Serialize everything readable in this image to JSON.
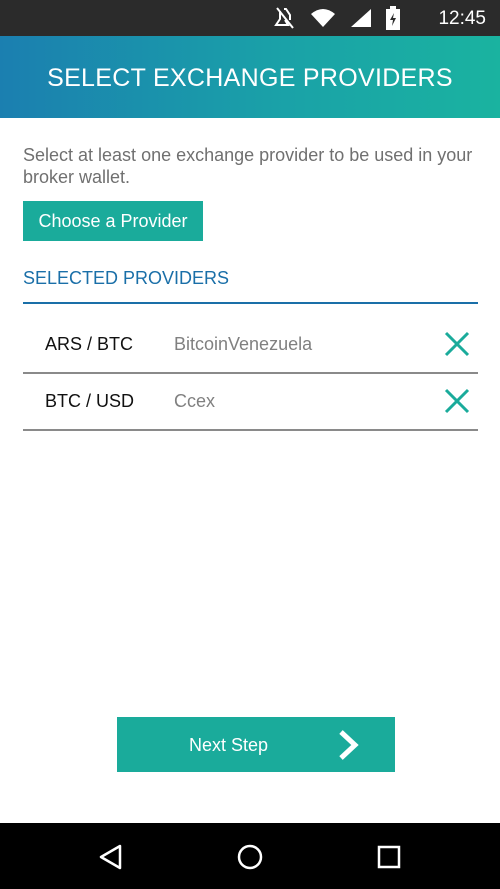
{
  "status_bar": {
    "time": "12:45",
    "icons": [
      "mute-icon",
      "wifi-icon",
      "signal-icon",
      "battery-icon"
    ]
  },
  "header": {
    "title": "SELECT EXCHANGE PROVIDERS"
  },
  "main": {
    "instruction": "Select at least one exchange provider to be used in your broker wallet.",
    "choose_button": "Choose a Provider",
    "section_title": "SELECTED PROVIDERS",
    "providers": [
      {
        "pair": "ARS / BTC",
        "name": "BitcoinVenezuela"
      },
      {
        "pair": "BTC / USD",
        "name": "Ccex"
      }
    ]
  },
  "footer": {
    "next_button": "Next Step"
  },
  "nav": {
    "items": [
      "back-icon",
      "home-icon",
      "recents-icon"
    ]
  },
  "colors": {
    "accent": "#1aab9b",
    "header_start": "#1b7fb0",
    "header_end": "#1ab3a0",
    "section": "#1a6fa8"
  }
}
